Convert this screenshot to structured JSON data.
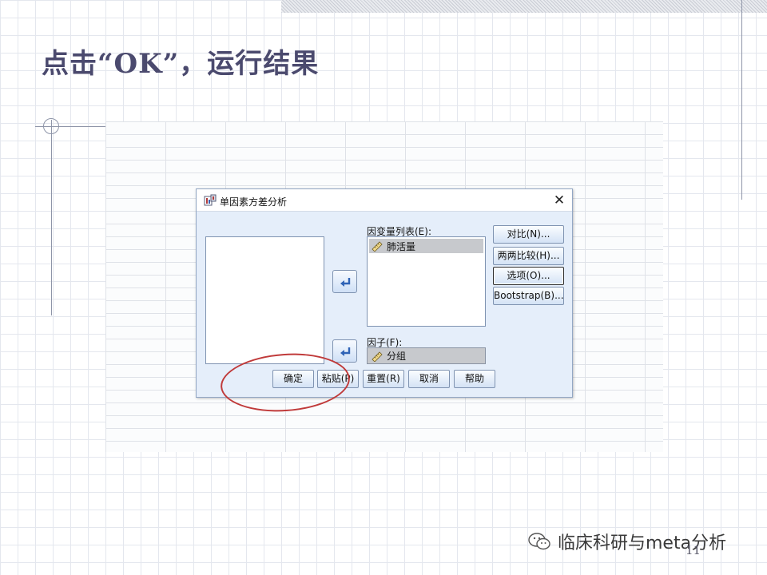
{
  "slide": {
    "title": "点击“OK”，运行结果",
    "page_number": "11",
    "watermark": "临床科研与meta分析"
  },
  "dialog": {
    "title": "单因素方差分析",
    "close_glyph": "✕",
    "dependent_list": {
      "label": "因变量列表(E):",
      "items": [
        "肺活量"
      ]
    },
    "factor": {
      "label": "因子(F):",
      "value": "分组"
    },
    "side_buttons": {
      "contrasts": "对比(N)...",
      "post_hoc": "两两比较(H)...",
      "options": "选项(O)...",
      "bootstrap": "Bootstrap(B)..."
    },
    "bottom_buttons": {
      "ok": "确定",
      "paste": "粘贴(P)",
      "reset": "重置(R)",
      "cancel": "取消",
      "help": "帮助"
    }
  },
  "colors": {
    "title_text": "#4b4a6e",
    "dialog_bg": "#e5eefa",
    "annotation_circle": "#c03a3a"
  }
}
